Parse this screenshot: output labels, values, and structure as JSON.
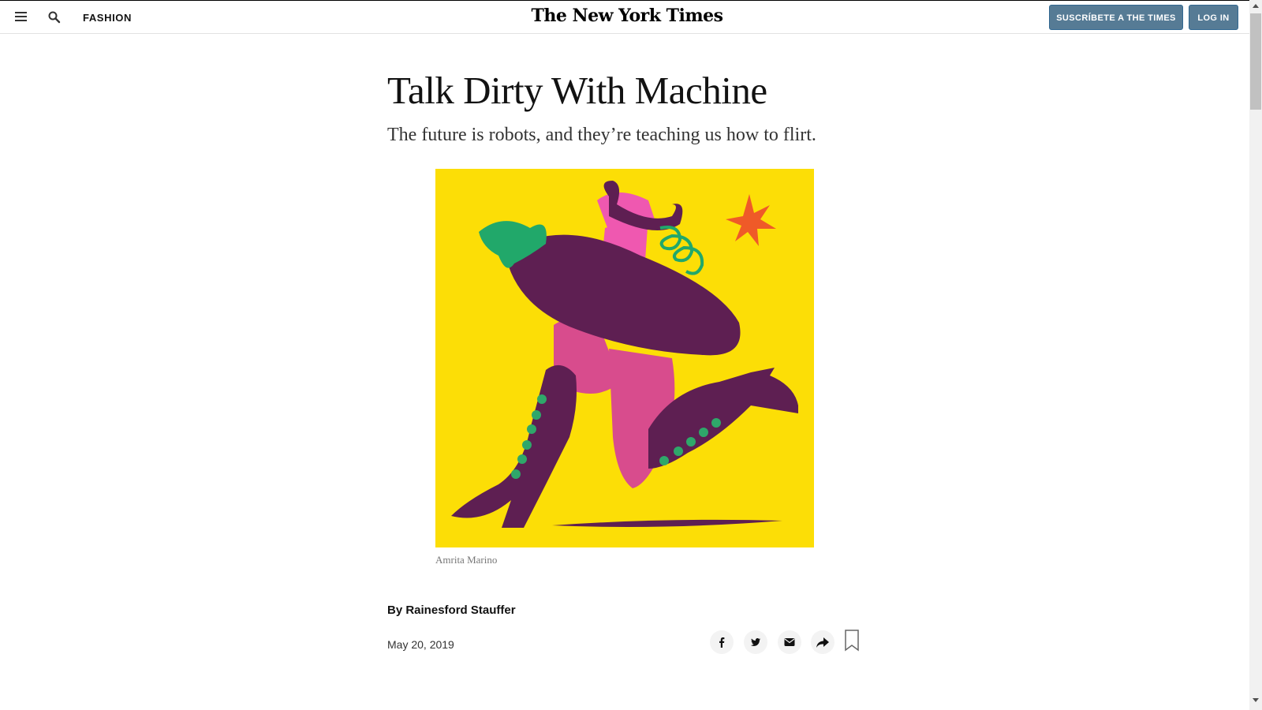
{
  "header": {
    "section": "FASHION",
    "masthead": "The New York Times",
    "subscribe_label": "SUSCRÍBETE A THE TIMES",
    "login_label": "LOG IN",
    "icons": [
      "menu-icon",
      "search-icon"
    ]
  },
  "article": {
    "headline": "Talk Dirty With Machine",
    "summary": "The future is robots, and they’re teaching us how to flirt.",
    "image_credit": "Amrita Marino",
    "byline": "By Rainesford Stauffer",
    "date": "May 20, 2019"
  },
  "share_tools": [
    "facebook-icon",
    "twitter-icon",
    "email-icon",
    "share-icon",
    "bookmark-icon"
  ],
  "colors": {
    "illustration_bg": "#fcde06",
    "eggplant": "#5e1f52",
    "button_bg": "#567b95"
  }
}
